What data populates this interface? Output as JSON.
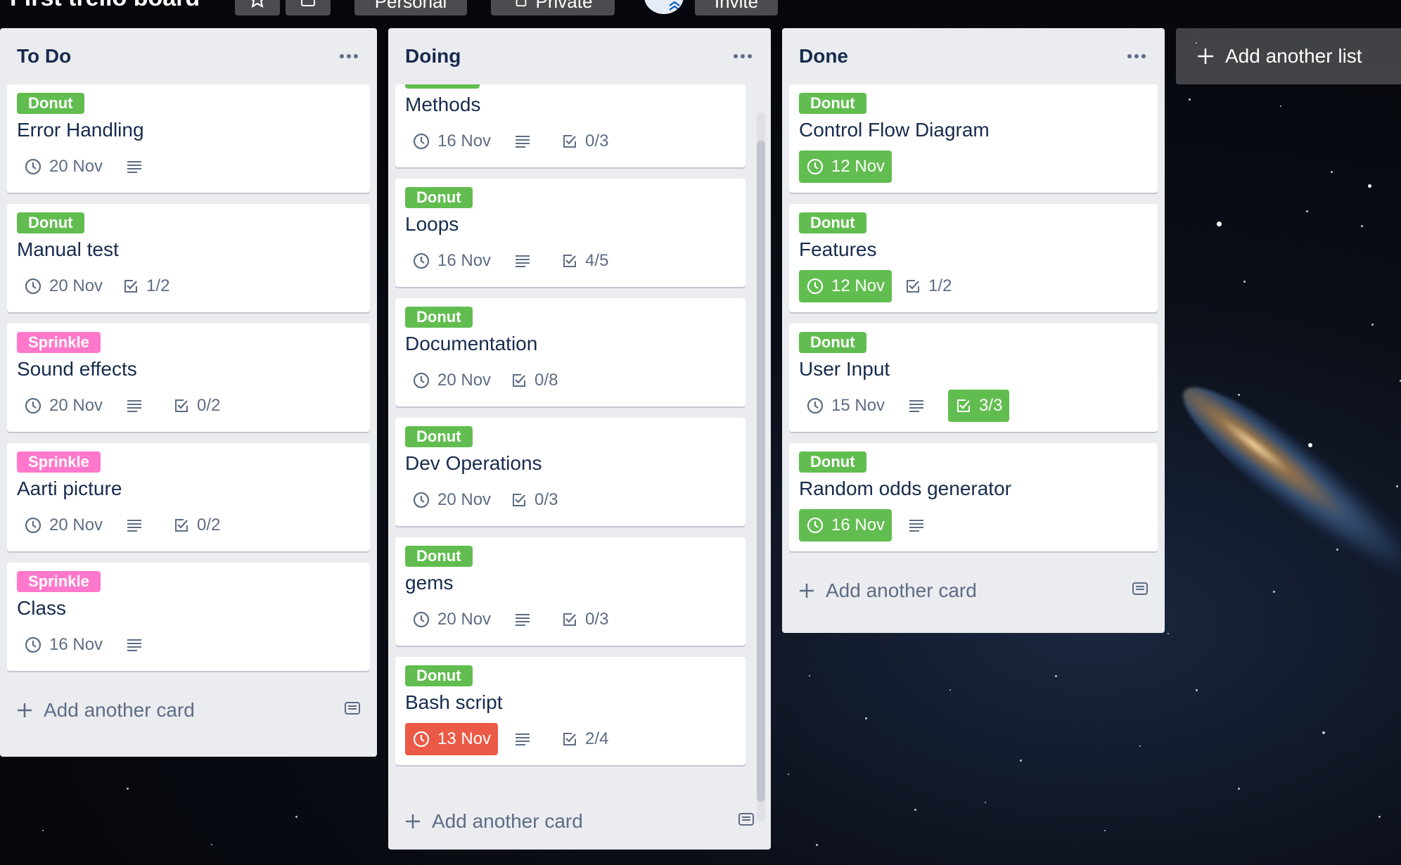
{
  "board": {
    "title": "First trello board",
    "visibility": "Personal",
    "privacy": "Private",
    "invite_label": "Invite"
  },
  "colors": {
    "donut_label": "#61bd4f",
    "sprinkle_label": "#ff78cb",
    "due_complete": "#61bd4f",
    "due_overdue": "#eb5a46",
    "list_bg": "#ebecf0"
  },
  "lists": [
    {
      "title": "To Do",
      "add_card_label": "Add another card",
      "cards": [
        {
          "label": "Donut",
          "label_color": "#61bd4f",
          "title": "Error Handling",
          "due": "20 Nov",
          "due_state": "normal",
          "has_description": true,
          "checklist": ""
        },
        {
          "label": "Donut",
          "label_color": "#61bd4f",
          "title": "Manual test",
          "due": "20 Nov",
          "due_state": "normal",
          "has_description": false,
          "checklist": "1/2"
        },
        {
          "label": "Sprinkle",
          "label_color": "#ff78cb",
          "title": "Sound effects",
          "due": "20 Nov",
          "due_state": "normal",
          "has_description": true,
          "checklist": "0/2"
        },
        {
          "label": "Sprinkle",
          "label_color": "#ff78cb",
          "title": "Aarti picture",
          "due": "20 Nov",
          "due_state": "normal",
          "has_description": true,
          "checklist": "0/2"
        },
        {
          "label": "Sprinkle",
          "label_color": "#ff78cb",
          "title": "Class",
          "due": "16 Nov",
          "due_state": "normal",
          "has_description": true,
          "checklist": ""
        }
      ]
    },
    {
      "title": "Doing",
      "add_card_label": "Add another card",
      "cards": [
        {
          "label": "",
          "label_color": "#61bd4f",
          "title": "Methods",
          "due": "16 Nov",
          "due_state": "normal",
          "has_description": true,
          "checklist": "0/3"
        },
        {
          "label": "Donut",
          "label_color": "#61bd4f",
          "title": "Loops",
          "due": "16 Nov",
          "due_state": "normal",
          "has_description": true,
          "checklist": "4/5"
        },
        {
          "label": "Donut",
          "label_color": "#61bd4f",
          "title": "Documentation",
          "due": "20 Nov",
          "due_state": "normal",
          "has_description": false,
          "checklist": "0/8"
        },
        {
          "label": "Donut",
          "label_color": "#61bd4f",
          "title": "Dev Operations",
          "due": "20 Nov",
          "due_state": "normal",
          "has_description": false,
          "checklist": "0/3"
        },
        {
          "label": "Donut",
          "label_color": "#61bd4f",
          "title": "gems",
          "due": "20 Nov",
          "due_state": "normal",
          "has_description": true,
          "checklist": "0/3"
        },
        {
          "label": "Donut",
          "label_color": "#61bd4f",
          "title": "Bash script",
          "due": "13 Nov",
          "due_state": "overdue",
          "has_description": true,
          "checklist": "2/4"
        }
      ]
    },
    {
      "title": "Done",
      "add_card_label": "Add another card",
      "cards": [
        {
          "label": "Donut",
          "label_color": "#61bd4f",
          "title": "Control Flow Diagram",
          "due": "12 Nov",
          "due_state": "complete",
          "has_description": false,
          "checklist": ""
        },
        {
          "label": "Donut",
          "label_color": "#61bd4f",
          "title": "Features",
          "due": "12 Nov",
          "due_state": "complete",
          "has_description": false,
          "checklist": "1/2"
        },
        {
          "label": "Donut",
          "label_color": "#61bd4f",
          "title": "User Input",
          "due": "15 Nov",
          "due_state": "normal",
          "has_description": true,
          "checklist": "3/3",
          "checklist_complete": true
        },
        {
          "label": "Donut",
          "label_color": "#61bd4f",
          "title": "Random odds generator",
          "due": "16 Nov",
          "due_state": "complete",
          "has_description": true,
          "checklist": ""
        }
      ]
    }
  ],
  "add_list_label": "Add another list"
}
